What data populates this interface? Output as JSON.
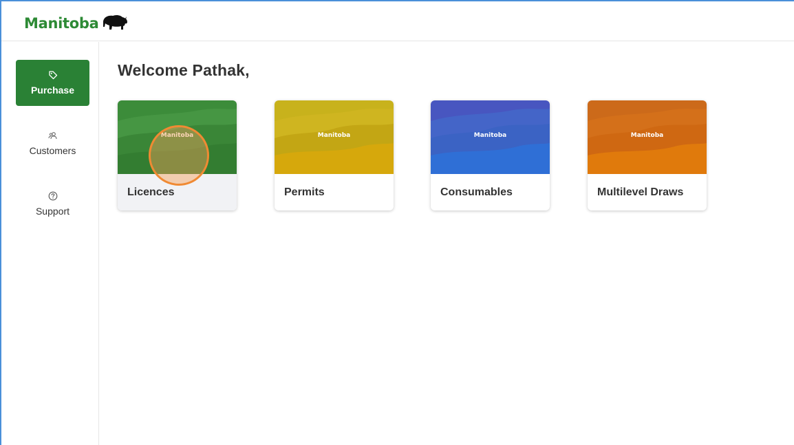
{
  "header": {
    "logo_text": "Manitoba"
  },
  "sidebar": {
    "items": [
      {
        "label": "Purchase",
        "icon": "tag-icon",
        "active": true
      },
      {
        "label": "Customers",
        "icon": "users-icon",
        "active": false
      },
      {
        "label": "Support",
        "icon": "help-circle-icon",
        "active": false
      }
    ]
  },
  "main": {
    "welcome": "Welcome Pathak,",
    "cards": [
      {
        "label": "Licences",
        "logo": "Manitoba",
        "color": "#3b8a3a"
      },
      {
        "label": "Permits",
        "logo": "Manitoba",
        "color": "#c9a80f"
      },
      {
        "label": "Consumables",
        "logo": "Manitoba",
        "color": "#3b63c7"
      },
      {
        "label": "Multilevel Draws",
        "logo": "Manitoba",
        "color": "#d9700f"
      }
    ]
  },
  "colors": {
    "brand_green": "#2d8a35",
    "active_nav": "#2a8135",
    "highlight": "#f08a33"
  }
}
